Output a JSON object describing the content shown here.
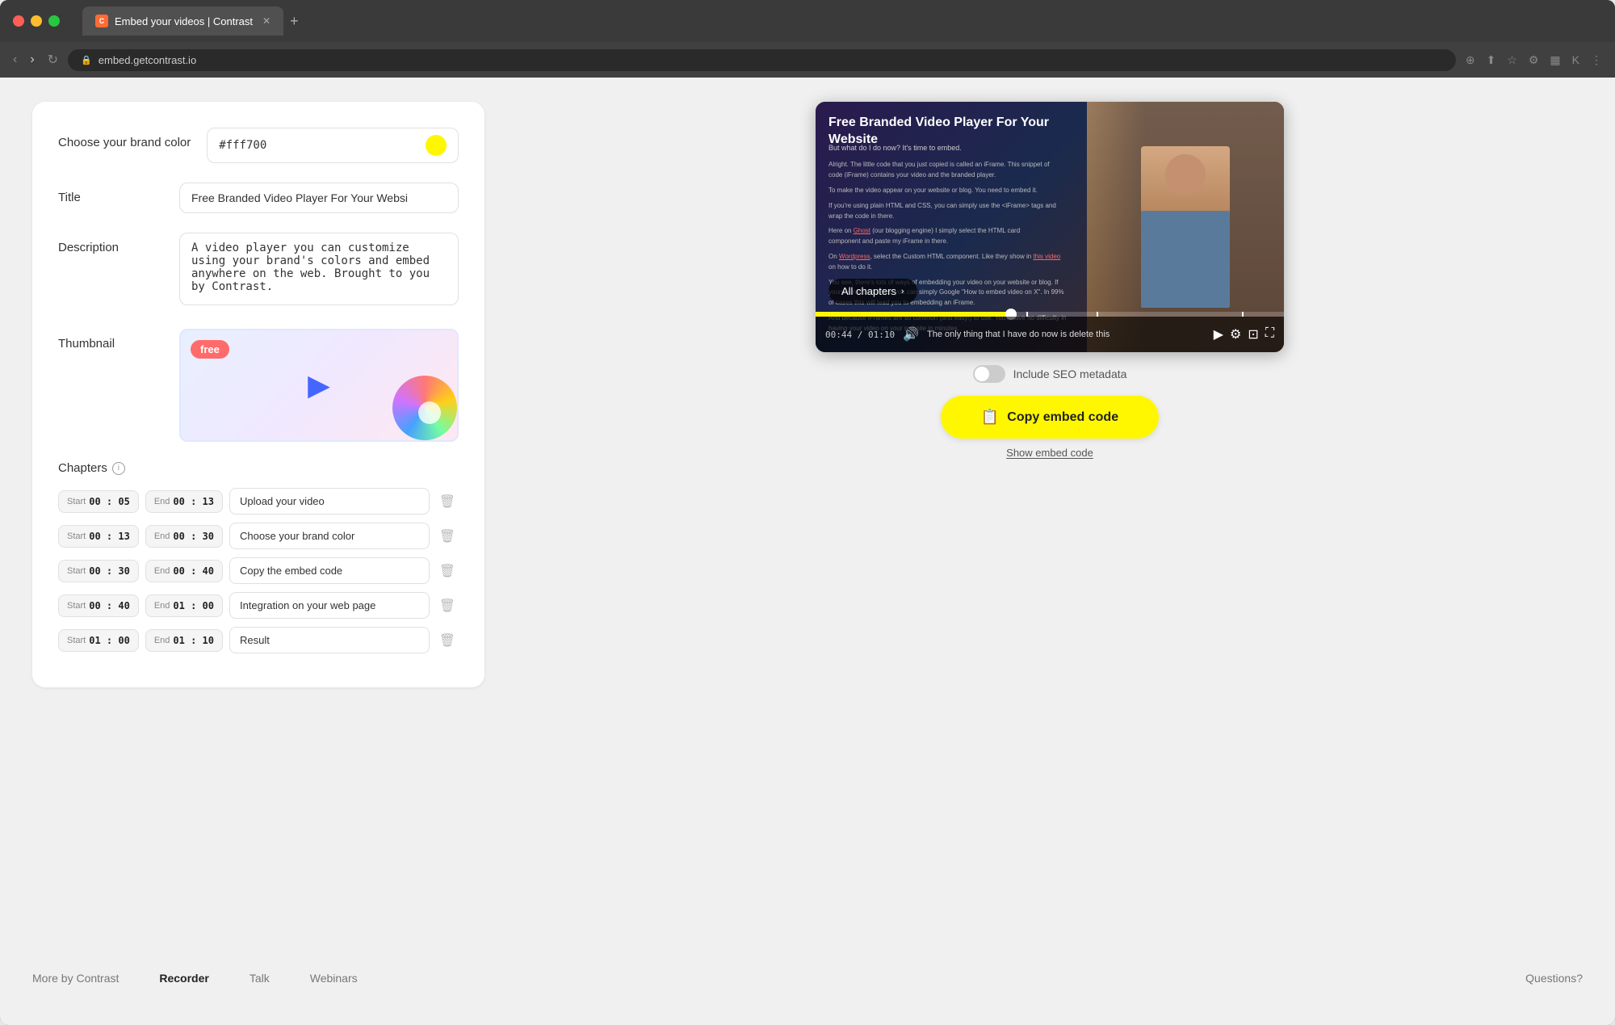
{
  "browser": {
    "tab_title": "Embed your videos | Contrast",
    "tab_icon": "C",
    "address": "embed.getcontrast.io",
    "new_tab_label": "+"
  },
  "form": {
    "brand_color_label": "Choose your brand color",
    "brand_color_value": "#fff700",
    "title_label": "Title",
    "title_value": "Free Branded Video Player For Your Websi",
    "description_label": "Description",
    "description_value": "A video player you can customize using your brand's colors and embed anywhere on the web. Brought to you by Contrast.",
    "thumbnail_label": "Thumbnail",
    "thumbnail_badge": "free",
    "chapters_label": "Chapters"
  },
  "chapters": [
    {
      "start": "00 : 05",
      "end": "00 : 13",
      "name": "Upload your video"
    },
    {
      "start": "00 : 13",
      "end": "00 : 30",
      "name": "Choose your brand color"
    },
    {
      "start": "00 : 30",
      "end": "00 : 40",
      "name": "Copy the embed code"
    },
    {
      "start": "00 : 40",
      "end": "01 : 00",
      "name": "Integration on your web page"
    },
    {
      "start": "01 : 00",
      "end": "01 : 10",
      "name": "Result"
    }
  ],
  "video": {
    "title": "Free Branded Video Player For Your Website",
    "chapters_btn": "All chapters",
    "time_current": "00:44",
    "time_total": "01:10",
    "subtitle_text": "The only thing that I have  do now is delete this"
  },
  "controls": {
    "seo_label": "Include SEO metadata",
    "copy_btn": "Copy embed code",
    "show_code_link": "Show embed code"
  },
  "footer": {
    "more_by": "More by Contrast",
    "recorder": "Recorder",
    "talk": "Talk",
    "webinars": "Webinars",
    "questions": "Questions?"
  }
}
